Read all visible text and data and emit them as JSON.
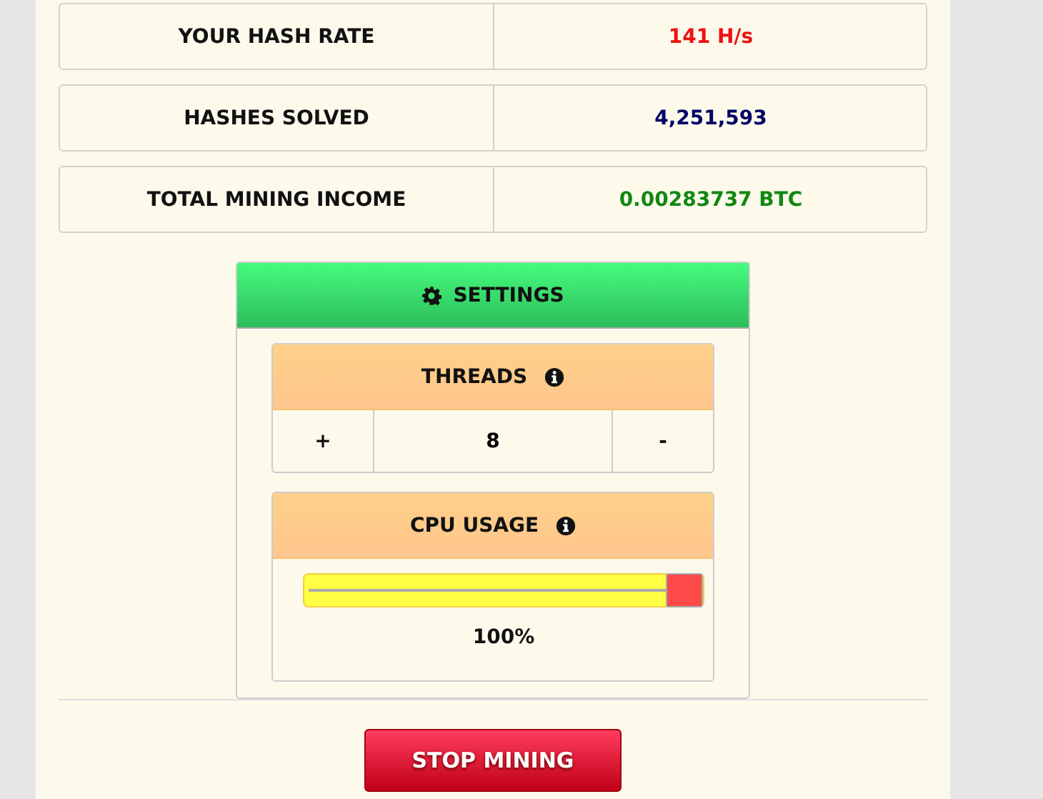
{
  "stats": [
    {
      "label": "YOUR HASH RATE",
      "value": "141 H/s",
      "color": "#ee1111"
    },
    {
      "label": "HASHES SOLVED",
      "value": "4,251,593",
      "color": "#000066"
    },
    {
      "label": "TOTAL MINING INCOME",
      "value": "0.00283737 BTC",
      "color": "#118811"
    }
  ],
  "settings": {
    "title": "SETTINGS",
    "threads": {
      "title": "THREADS",
      "plus": "+",
      "value": "8",
      "minus": "-"
    },
    "cpu": {
      "title": "CPU USAGE",
      "level": 1,
      "reading": "100%"
    }
  },
  "button": "STOP MINING"
}
